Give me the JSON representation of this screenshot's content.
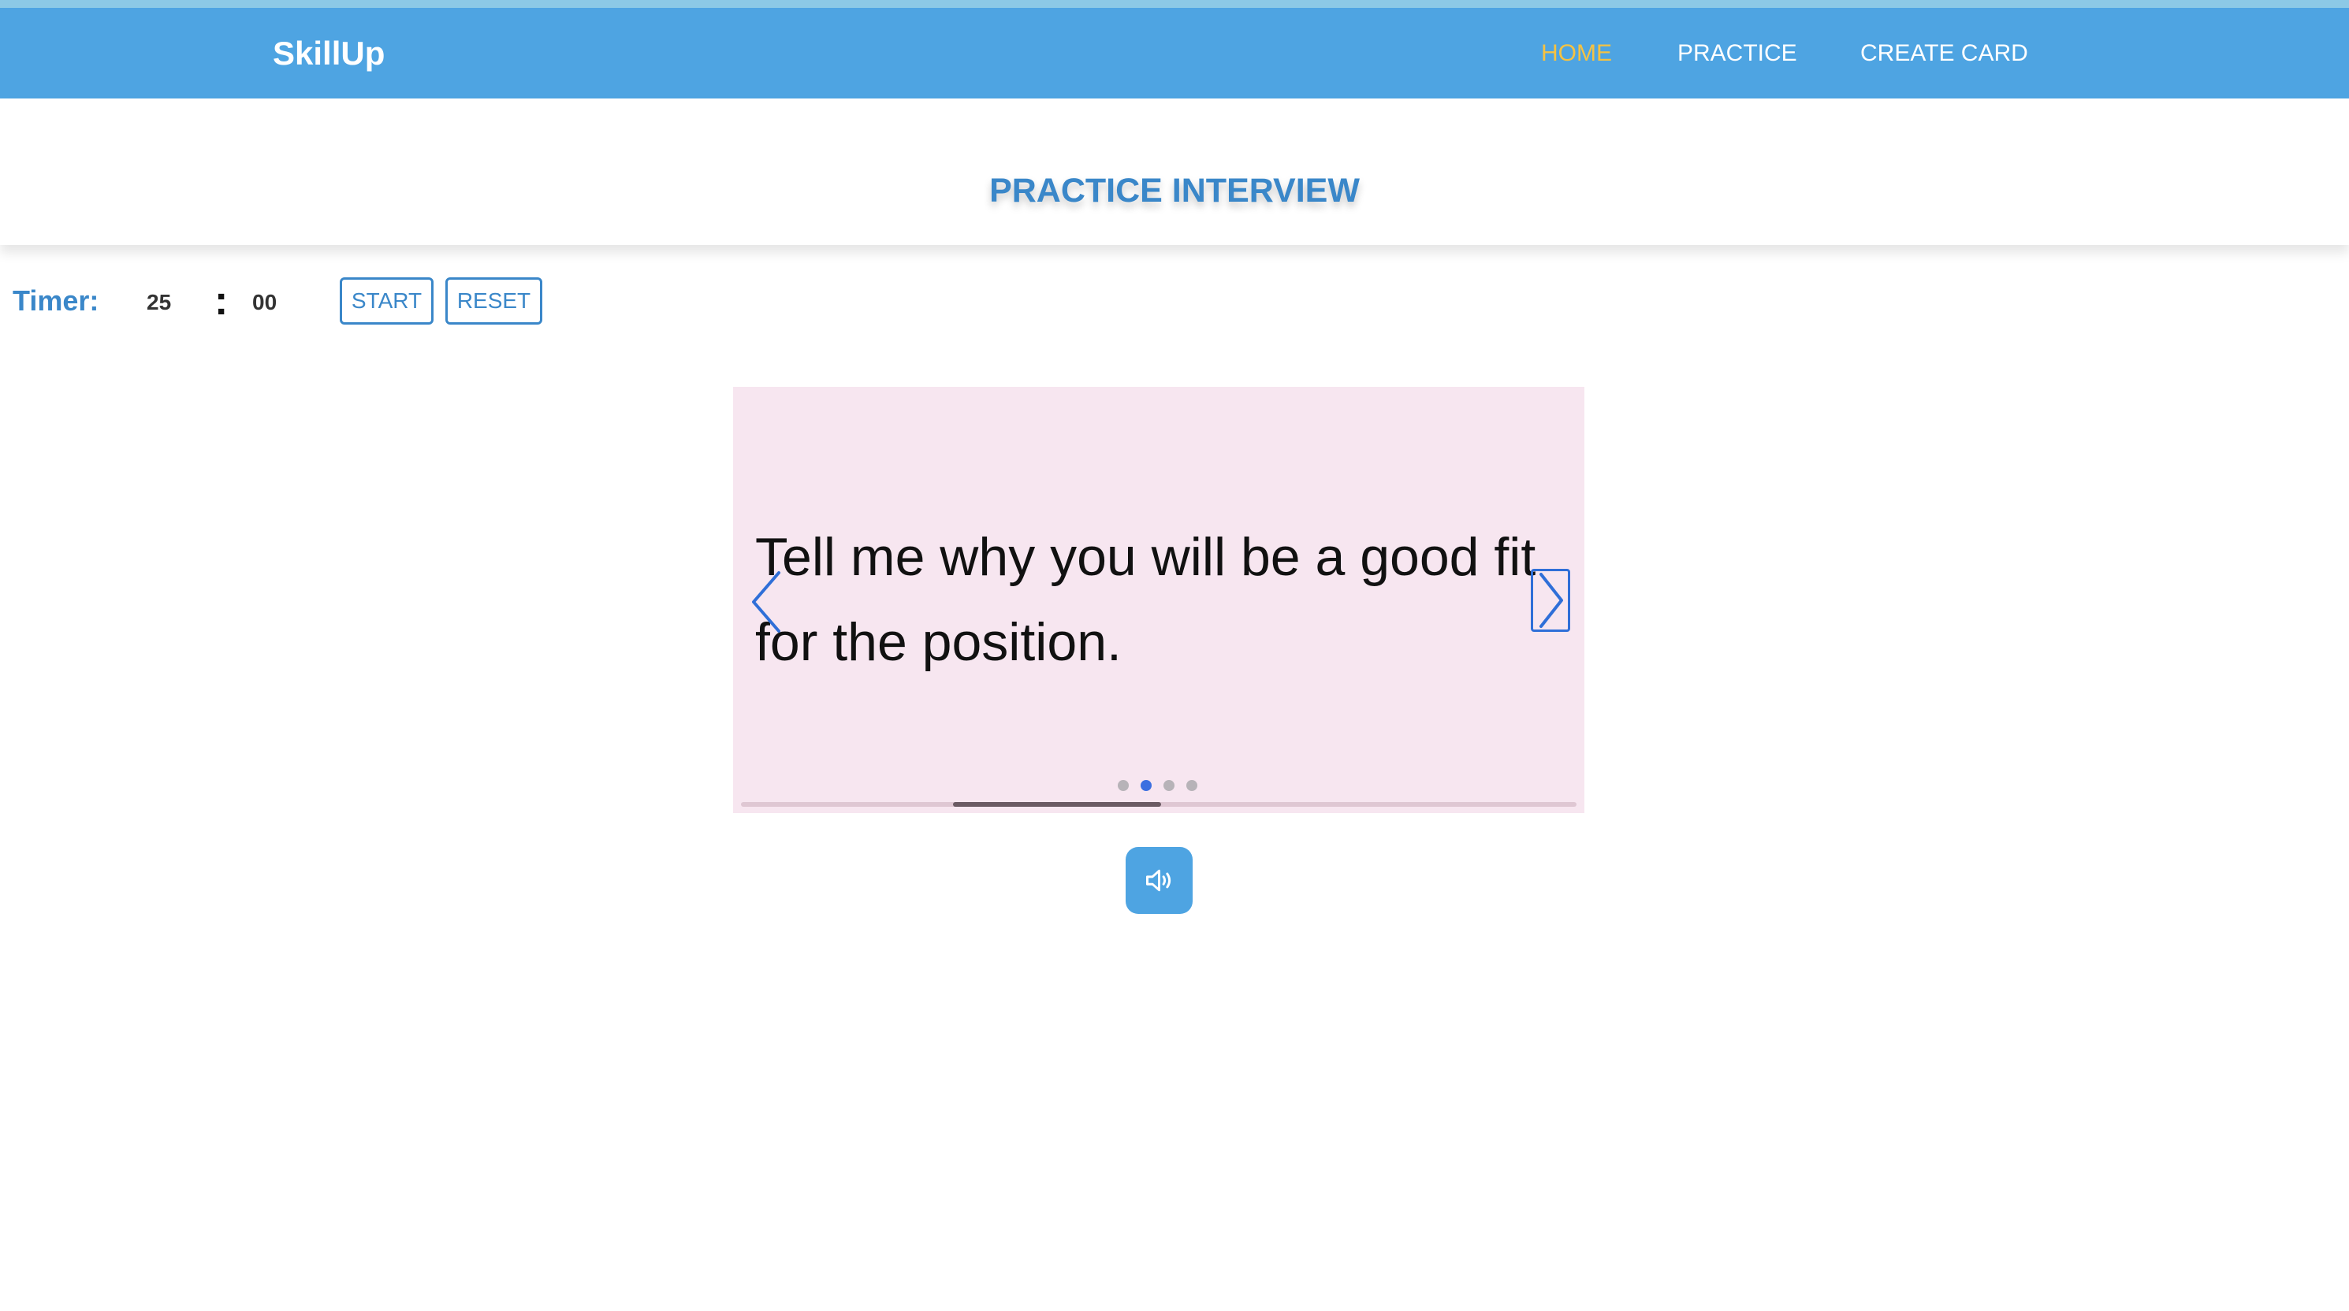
{
  "nav": {
    "brand": "SkillUp",
    "links": [
      {
        "label": "HOME",
        "active": true
      },
      {
        "label": "PRACTICE",
        "active": false
      },
      {
        "label": "CREATE CARD",
        "active": false
      }
    ]
  },
  "header": {
    "title": "PRACTICE INTERVIEW"
  },
  "timer": {
    "label": "Timer:",
    "minutes": "25",
    "separator": ":",
    "seconds": "00",
    "start_label": "START",
    "reset_label": "RESET"
  },
  "carousel": {
    "question": "Tell me why you will be a good fit for the position.",
    "slide_count": 4,
    "active_index": 1,
    "scroll_progress": 0.25,
    "prev_icon": "chevron-left-icon",
    "next_icon": "chevron-right-icon"
  },
  "speak_button": {
    "icon": "speaker-icon"
  },
  "colors": {
    "nav_bg": "#4ea4e2",
    "active_nav": "#f5c242",
    "accent": "#3a87c9",
    "card_bg": "#f7e6f0",
    "active_dot": "#3b6fe0"
  }
}
